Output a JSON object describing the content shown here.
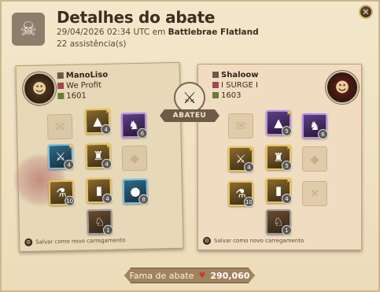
{
  "header": {
    "title": "Detalhes do abate",
    "datetime": "29/04/2026 02:34 UTC em",
    "location": "Battlebrae Flatland",
    "assists": "22 assistência(s)"
  },
  "victim_section_label": "ABATEU",
  "killer": {
    "name": "ManoLiso",
    "guild": "We Profit",
    "ip": "1601",
    "save_text": "Salvar como novo carregamento"
  },
  "victim": {
    "name": "Shaloow",
    "guild": "I SURGE I",
    "ip": "1603",
    "save_text": "Salvar como novo carregamento"
  },
  "fame": {
    "label": "Fama de abate",
    "value": "290,060"
  },
  "icons": {
    "skull": "skull-crossbones-icon",
    "close": "close-icon",
    "swords": "crossed-swords-icon"
  }
}
